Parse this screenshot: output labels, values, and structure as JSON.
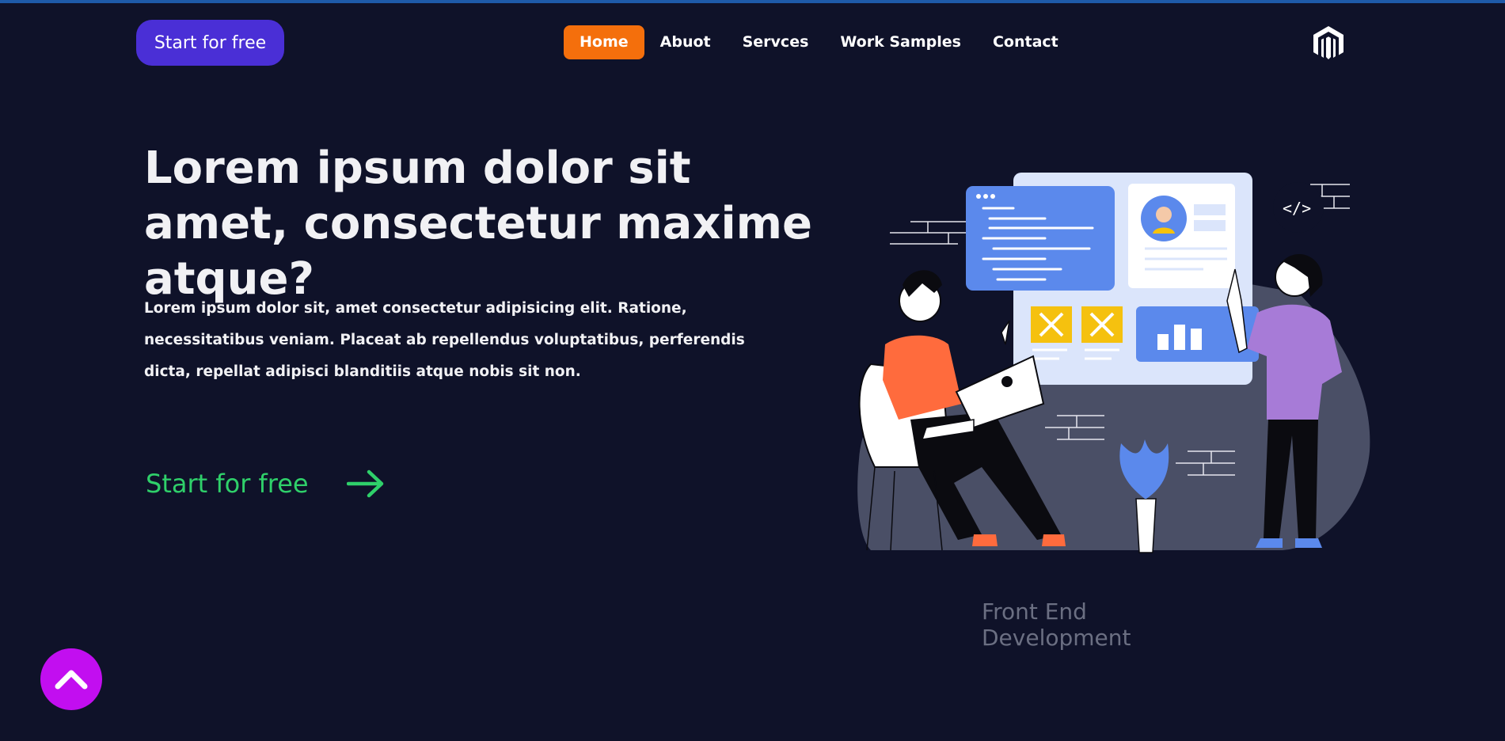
{
  "header": {
    "cta_label": "Start for free",
    "nav": [
      {
        "label": "Home",
        "active": true
      },
      {
        "label": "Abuot",
        "active": false
      },
      {
        "label": "Servces",
        "active": false
      },
      {
        "label": "Work Samples",
        "active": false
      },
      {
        "label": "Contact",
        "active": false
      }
    ],
    "logo_icon": "magento-logo-icon"
  },
  "hero": {
    "title": "Lorem ipsum dolor sit amet, consectetur maxime atque?",
    "text": "Lorem ipsum dolor sit, amet consectetur adipisicing elit. Ratione, necessitatibus veniam. Placeat ab repellendus voluptatibus, perferendis dicta, repellat adipisci blanditiis atque nobis sit non.",
    "cta_label": "Start for free",
    "illustration_code_label": "</>",
    "caption": "Front End Development"
  },
  "colors": {
    "background": "#0f1229",
    "primary_button": "#4a2fd6",
    "nav_active": "#f46f0c",
    "cta_green": "#2fd06a",
    "scroll_top": "#c20ef0",
    "caption": "#6b6f82"
  },
  "scroll_top_icon": "chevron-up-icon"
}
